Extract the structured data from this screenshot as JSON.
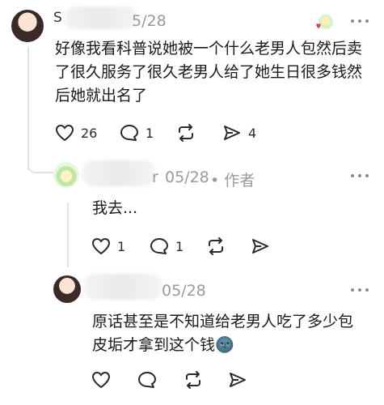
{
  "comments": [
    {
      "date": "5/28",
      "text": "好像我看科普说她被一个什么老男人包然后卖了很久服务了很久老男人给了她生日很多钱然后她就出名了",
      "likes": "26",
      "replies": "1",
      "shares": "4"
    },
    {
      "name_tail": "r",
      "date": "05/28",
      "author_tag": "• 作者",
      "text": "我去...",
      "likes": "1",
      "replies": "1"
    },
    {
      "date": "05/28",
      "text": "原话甚至是不知道给老男人吃了多少包皮垢才拿到这个钱",
      "emoji": "🌚"
    }
  ],
  "icons": {
    "like": "heart-icon",
    "reply": "comment-bubble-icon",
    "repost": "repost-icon",
    "share": "send-icon",
    "more": "more-dots-icon"
  }
}
